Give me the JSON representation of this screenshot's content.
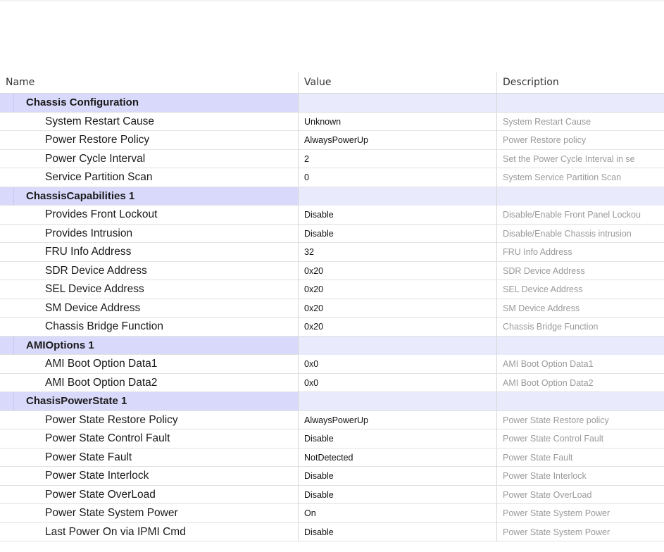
{
  "columns": {
    "name": "Name",
    "value": "Value",
    "description": "Description"
  },
  "groups": [
    {
      "title": "Chassis Configuration",
      "items": [
        {
          "name": "System Restart Cause",
          "value": "Unknown",
          "description": "System Restart Cause"
        },
        {
          "name": "Power Restore Policy",
          "value": "AlwaysPowerUp",
          "description": "Power Restore policy"
        },
        {
          "name": "Power Cycle Interval",
          "value": "2",
          "description": "Set the Power Cycle Interval in se"
        },
        {
          "name": "Service Partition Scan",
          "value": "0",
          "description": "System Service Partition Scan"
        }
      ]
    },
    {
      "title": "ChassisCapabilities 1",
      "items": [
        {
          "name": "Provides Front Lockout",
          "value": "Disable",
          "description": "Disable/Enable Front Panel Lockou"
        },
        {
          "name": "Provides Intrusion",
          "value": "Disable",
          "description": "Disable/Enable Chassis intrusion"
        },
        {
          "name": "FRU Info Address",
          "value": "32",
          "description": "FRU Info Address"
        },
        {
          "name": "SDR Device Address",
          "value": "0x20",
          "description": "SDR Device Address"
        },
        {
          "name": "SEL Device Address",
          "value": "0x20",
          "description": "SEL Device Address"
        },
        {
          "name": "SM Device Address",
          "value": "0x20",
          "description": "SM Device Address"
        },
        {
          "name": "Chassis Bridge Function",
          "value": "0x20",
          "description": "Chassis Bridge Function"
        }
      ]
    },
    {
      "title": "AMIOptions 1",
      "items": [
        {
          "name": "AMI Boot Option Data1",
          "value": "0x0",
          "description": "AMI Boot Option Data1"
        },
        {
          "name": "AMI Boot Option Data2",
          "value": "0x0",
          "description": "AMI Boot Option Data2"
        }
      ]
    },
    {
      "title": "ChasisPowerState 1",
      "items": [
        {
          "name": "Power State Restore Policy",
          "value": "AlwaysPowerUp",
          "description": "Power State Restore policy"
        },
        {
          "name": "Power State Control Fault",
          "value": "Disable",
          "description": "Power State Control Fault"
        },
        {
          "name": "Power State Fault",
          "value": "NotDetected",
          "description": "Power State Fault"
        },
        {
          "name": "Power State Interlock",
          "value": "Disable",
          "description": "Power State Interlock"
        },
        {
          "name": "Power State OverLoad",
          "value": "Disable",
          "description": "Power State OverLoad"
        },
        {
          "name": "Power State System Power",
          "value": "On",
          "description": "Power State System Power"
        },
        {
          "name": "Last Power On via IPMI Cmd",
          "value": "Disable",
          "description": "Power State System Power"
        }
      ]
    }
  ],
  "colors": {
    "group_row_bg": "#d9d9fb",
    "description_text": "#9a9a9a"
  }
}
